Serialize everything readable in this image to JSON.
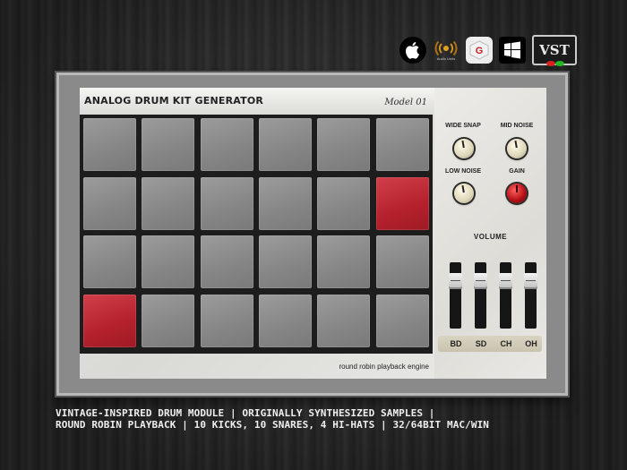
{
  "platforms": [
    {
      "name": "apple-icon",
      "label": ""
    },
    {
      "name": "audio-units-icon",
      "label": "Audio Units"
    },
    {
      "name": "aax-icon",
      "label": "AAX"
    },
    {
      "name": "windows-icon",
      "label": ""
    },
    {
      "name": "vst-icon",
      "label": "VST"
    }
  ],
  "plugin": {
    "title": "ANALOG DRUM KIT GENERATOR",
    "model": "Model 01",
    "footer": "round robin playback engine"
  },
  "pads": {
    "rows": 4,
    "cols": 6,
    "active": [
      [
        1,
        5
      ],
      [
        3,
        0
      ]
    ],
    "colors": {
      "pad": "#8c8c8c",
      "active": "#b4212c"
    }
  },
  "knobs": [
    {
      "label": "WIDE SNAP",
      "color": "cream"
    },
    {
      "label": "MID NOISE",
      "color": "cream"
    },
    {
      "label": "LOW NOISE",
      "color": "cream"
    },
    {
      "label": "GAIN",
      "color": "red"
    }
  ],
  "volume": {
    "label": "VOLUME",
    "channels": [
      {
        "label": "BD",
        "level": 0.78
      },
      {
        "label": "SD",
        "level": 0.78
      },
      {
        "label": "CH",
        "level": 0.78
      },
      {
        "label": "OH",
        "level": 0.78
      }
    ]
  },
  "description": {
    "line1": "VINTAGE-INSPIRED DRUM MODULE | ORIGINALLY SYNTHESIZED SAMPLES |",
    "line2": "ROUND ROBIN PLAYBACK | 10 KICKS, 10 SNARES, 4 HI-HATS | 32/64BIT MAC/WIN"
  }
}
